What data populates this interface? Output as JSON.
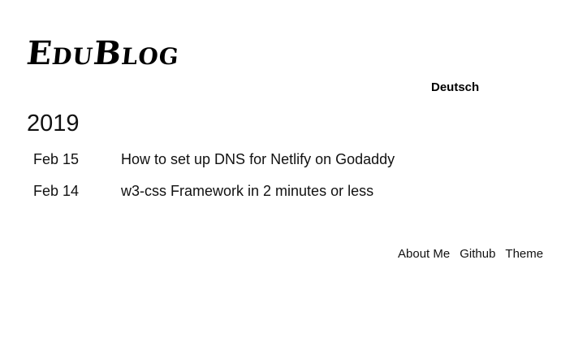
{
  "header": {
    "site_title": "EduBlog",
    "language_link": "Deutsch"
  },
  "archive": {
    "year": "2019",
    "posts": [
      {
        "date": "Feb 15",
        "title": "How to set up DNS for Netlify on Godaddy"
      },
      {
        "date": "Feb 14",
        "title": "w3-css Framework in 2 minutes or less"
      }
    ]
  },
  "footer": {
    "links": [
      "About Me",
      "Github",
      "Theme"
    ]
  }
}
